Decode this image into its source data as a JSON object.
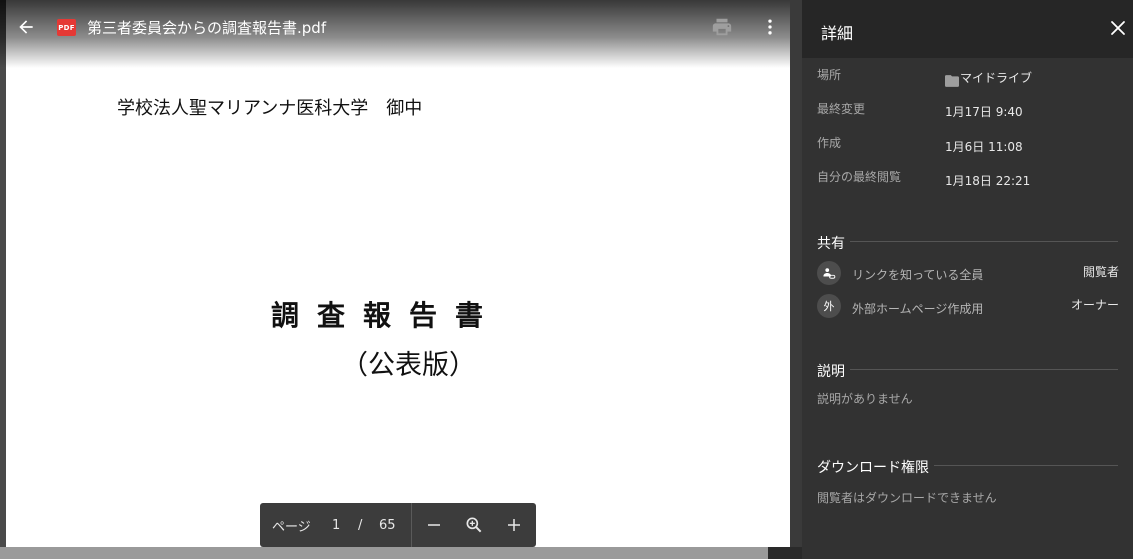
{
  "viewer": {
    "file_name": "第三者委員会からの調査報告書.pdf",
    "file_badge": "PDF",
    "icons": {
      "back": "arrow-left-icon",
      "print": "printer-icon",
      "more": "more-vert-icon"
    }
  },
  "document": {
    "addressee": "学校法人聖マリアンナ医科大学　御中",
    "title": "調査報告書",
    "subtitle": "（公表版）"
  },
  "zoombar": {
    "page_label": "ページ",
    "current_page": "1",
    "separator": "/",
    "total_pages": "65",
    "icons": {
      "zoom_out": "minus-icon",
      "fit": "zoom-icon",
      "zoom_in": "plus-icon"
    }
  },
  "details": {
    "title": "詳細",
    "rows": {
      "location": {
        "label": "場所",
        "value": "マイドライブ"
      },
      "modified": {
        "label": "最終変更",
        "value": "1月17日 9:40"
      },
      "created": {
        "label": "作成",
        "value": "1月6日 11:08"
      },
      "last_viewed": {
        "label": "自分の最終閲覧",
        "value": "1月18日 22:21"
      }
    },
    "sharing": {
      "heading": "共有",
      "entries": [
        {
          "name": "リンクを知っている全員",
          "role": "閲覧者",
          "icon": "link-people-icon"
        },
        {
          "name": "外部ホームページ作成用",
          "role": "オーナー",
          "avatar_letter": "外"
        }
      ]
    },
    "description": {
      "heading": "説明",
      "text": "説明がありません"
    },
    "download": {
      "heading": "ダウンロード権限",
      "text": "閲覧者はダウンロードできません"
    }
  },
  "colors": {
    "panel_bg": "#323232",
    "panel_header_bg": "#262626",
    "pdf_red": "#e53935",
    "zoombar_bg": "#3c3c3c"
  }
}
